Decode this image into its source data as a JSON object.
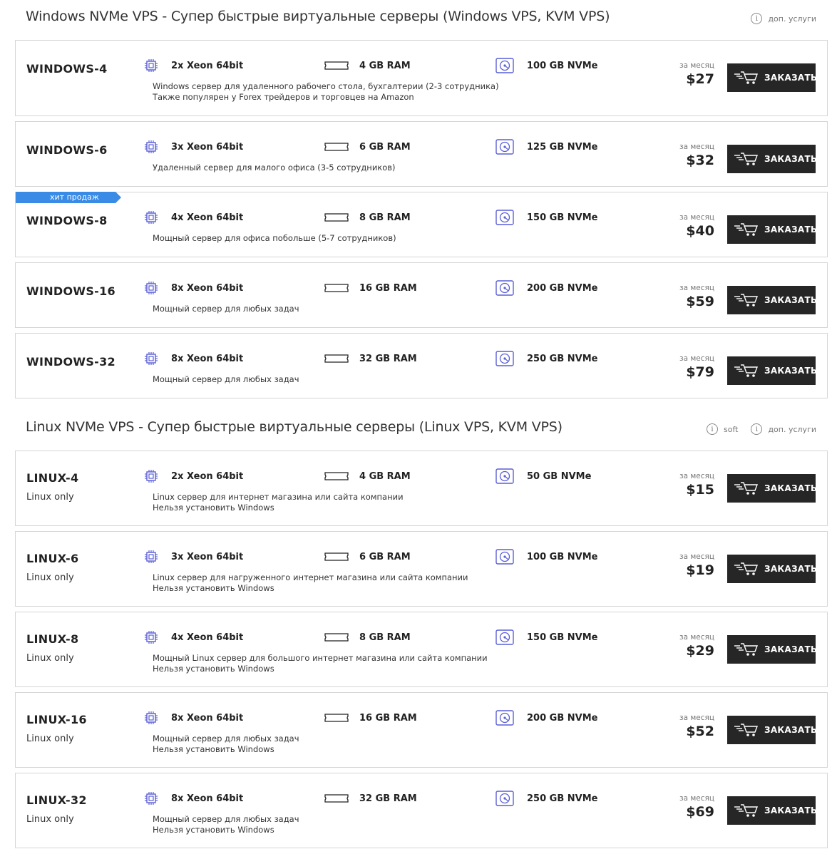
{
  "windows": {
    "title": "Windows NVMe VPS - Супер быстрые виртуальные серверы (Windows VPS, KVM VPS)",
    "extra_label": "доп. услуги",
    "plans": [
      {
        "name": "WINDOWS-4",
        "cpu": "2x Xeon 64bit",
        "ram": "4 GB RAM",
        "disk": "100 GB NVMe",
        "desc1": "Windows сервер для удаленного рабочего стола, бухгалтерии (2-3 сотрудника)",
        "desc2": "Также популярен у Forex трейдеров и торговцев на Amazon",
        "period": "за месяц",
        "price": "$27",
        "button": "ЗАКАЗАТЬ"
      },
      {
        "name": "WINDOWS-6",
        "cpu": "3x Xeon 64bit",
        "ram": "6 GB RAM",
        "disk": "125 GB NVMe",
        "desc1": "Удаленный сервер для малого офиса (3-5 сотрудников)",
        "desc2": "",
        "period": "за месяц",
        "price": "$32",
        "button": "ЗАКАЗАТЬ"
      },
      {
        "name": "WINDOWS-8",
        "badge": "хит продаж",
        "cpu": "4x Xeon 64bit",
        "ram": "8 GB RAM",
        "disk": "150 GB NVMe",
        "desc1": "Мощный сервер для офиса побольше (5-7 сотрудников)",
        "desc2": "",
        "period": "за месяц",
        "price": "$40",
        "button": "ЗАКАЗАТЬ"
      },
      {
        "name": "WINDOWS-16",
        "cpu": "8x Xeon 64bit",
        "ram": "16 GB RAM",
        "disk": "200 GB NVMe",
        "desc1": "Мощный сервер для любых задач",
        "desc2": "",
        "period": "за месяц",
        "price": "$59",
        "button": "ЗАКАЗАТЬ"
      },
      {
        "name": "WINDOWS-32",
        "cpu": "8x Xeon 64bit",
        "ram": "32 GB RAM",
        "disk": "250 GB NVMe",
        "desc1": "Мощный сервер для любых задач",
        "desc2": "",
        "period": "за месяц",
        "price": "$79",
        "button": "ЗАКАЗАТЬ"
      }
    ]
  },
  "linux": {
    "title": "Linux NVMe VPS - Супер быстрые виртуальные серверы (Linux VPS, KVM VPS)",
    "soft_label": "soft",
    "extra_label": "доп. услуги",
    "plans": [
      {
        "name": "LINUX-4",
        "sub": "Linux only",
        "cpu": "2x Xeon 64bit",
        "ram": "4 GB RAM",
        "disk": "50 GB NVMe",
        "desc1": "Linux сервер для интернет магазина или сайта компании",
        "desc2": "Нельзя установить Windows",
        "period": "за месяц",
        "price": "$15",
        "button": "ЗАКАЗАТЬ"
      },
      {
        "name": "LINUX-6",
        "sub": "Linux only",
        "cpu": "3x Xeon 64bit",
        "ram": "6 GB RAM",
        "disk": "100 GB NVMe",
        "desc1": "Linux сервер для нагруженного интернет магазина или сайта компании",
        "desc2": "Нельзя установить Windows",
        "period": "за месяц",
        "price": "$19",
        "button": "ЗАКАЗАТЬ"
      },
      {
        "name": "LINUX-8",
        "sub": "Linux only",
        "cpu": "4x Xeon 64bit",
        "ram": "8 GB RAM",
        "disk": "150 GB NVMe",
        "desc1": "Мощный Linux сервер для большого интернет магазина или сайта компании",
        "desc2": "Нельзя установить Windows",
        "period": "за месяц",
        "price": "$29",
        "button": "ЗАКАЗАТЬ"
      },
      {
        "name": "LINUX-16",
        "sub": "Linux only",
        "cpu": "8x Xeon 64bit",
        "ram": "16 GB RAM",
        "disk": "200 GB NVMe",
        "desc1": "Мощный сервер для любых задач",
        "desc2": "Нельзя установить Windows",
        "period": "за месяц",
        "price": "$52",
        "button": "ЗАКАЗАТЬ"
      },
      {
        "name": "LINUX-32",
        "sub": "Linux only",
        "cpu": "8x Xeon 64bit",
        "ram": "32 GB RAM",
        "disk": "250 GB NVMe",
        "desc1": "Мощный сервер для любых задач",
        "desc2": "Нельзя установить Windows",
        "period": "за месяц",
        "price": "$69",
        "button": "ЗАКАЗАТЬ"
      }
    ]
  },
  "icons": {
    "cpu": "cpu-chip-icon",
    "ram": "ram-module-icon",
    "disk": "disk-drive-icon",
    "cart": "shopping-cart-icon",
    "info": "info-icon"
  },
  "colors": {
    "accent": "#5a5fd6",
    "badge": "#3a8be6",
    "button": "#262626"
  }
}
